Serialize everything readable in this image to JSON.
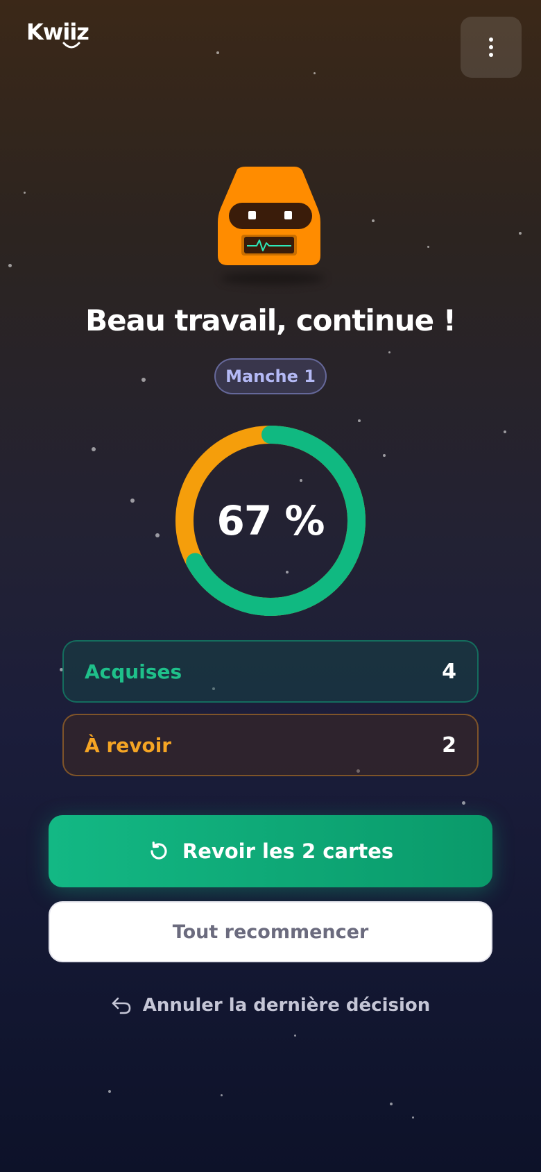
{
  "app": {
    "logo_text": "Kwiiz",
    "menu_icon": "more-vertical-icon"
  },
  "result": {
    "title": "Beau travail, continue !",
    "round_label": "Manche 1",
    "score_text": "67 %",
    "score_fraction": 0.67
  },
  "stats": {
    "acquired": {
      "label": "Acquises",
      "value": "4",
      "color": "#1fc08a"
    },
    "review": {
      "label": "À revoir",
      "value": "2",
      "color": "#f5a524"
    }
  },
  "actions": {
    "review_label": "Revoir les 2 cartes",
    "review_icon": "refresh-icon",
    "restart_label": "Tout recommencer",
    "undo_label": "Annuler la dernière décision",
    "undo_icon": "undo-icon"
  },
  "colors": {
    "success": "#13b884",
    "warning": "#f5a524",
    "mascot": "#ff8c00"
  }
}
